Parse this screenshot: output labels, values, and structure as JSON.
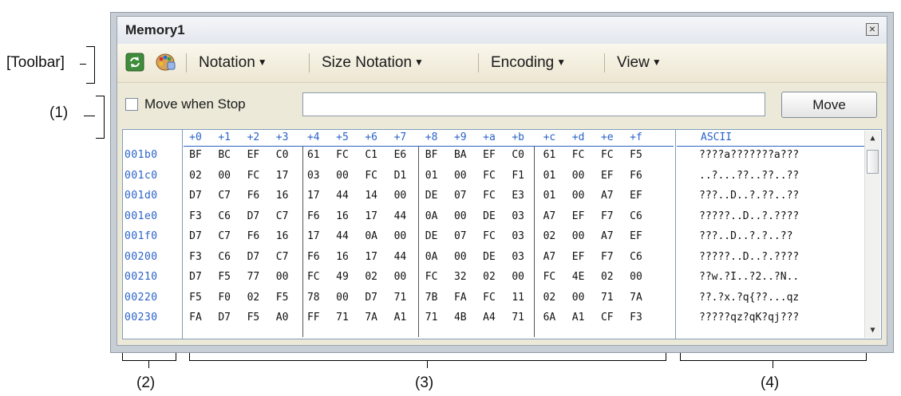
{
  "annotations": {
    "toolbar_label": "[Toolbar]",
    "option_label": "(1)",
    "addr_label": "(2)",
    "data_label": "(3)",
    "ascii_label": "(4)"
  },
  "window": {
    "title": "Memory1",
    "close_icon": "close-icon"
  },
  "toolbar": {
    "refresh_icon": "refresh-icon",
    "palette_icon": "palette-icon",
    "menus": [
      {
        "label": "Notation"
      },
      {
        "label": "Size Notation"
      },
      {
        "label": "Encoding"
      },
      {
        "label": "View"
      }
    ]
  },
  "options": {
    "checkbox_label": "Move when Stop",
    "checked": false,
    "address_value": "",
    "move_button": "Move"
  },
  "grid": {
    "header_offsets": [
      "+0",
      "+1",
      "+2",
      "+3",
      "+4",
      "+5",
      "+6",
      "+7",
      "+8",
      "+9",
      "+a",
      "+b",
      "+c",
      "+d",
      "+e",
      "+f"
    ],
    "ascii_header": "ASCII",
    "rows": [
      {
        "addr": "001b0",
        "bytes": [
          "BF",
          "BC",
          "EF",
          "C0",
          "61",
          "FC",
          "C1",
          "E6",
          "BF",
          "BA",
          "EF",
          "C0",
          "61",
          "FC",
          "FC",
          "F5"
        ],
        "ascii": "????a???????a???"
      },
      {
        "addr": "001c0",
        "bytes": [
          "02",
          "00",
          "FC",
          "17",
          "03",
          "00",
          "FC",
          "D1",
          "01",
          "00",
          "FC",
          "F1",
          "01",
          "00",
          "EF",
          "F6"
        ],
        "ascii": "..?...??..??..??"
      },
      {
        "addr": "001d0",
        "bytes": [
          "D7",
          "C7",
          "F6",
          "16",
          "17",
          "44",
          "14",
          "00",
          "DE",
          "07",
          "FC",
          "E3",
          "01",
          "00",
          "A7",
          "EF"
        ],
        "ascii": "???..D..?.??..??"
      },
      {
        "addr": "001e0",
        "bytes": [
          "F3",
          "C6",
          "D7",
          "C7",
          "F6",
          "16",
          "17",
          "44",
          "0A",
          "00",
          "DE",
          "03",
          "A7",
          "EF",
          "F7",
          "C6"
        ],
        "ascii": "?????..D..?.????"
      },
      {
        "addr": "001f0",
        "bytes": [
          "D7",
          "C7",
          "F6",
          "16",
          "17",
          "44",
          "0A",
          "00",
          "DE",
          "07",
          "FC",
          "03",
          "02",
          "00",
          "A7",
          "EF"
        ],
        "ascii": "???..D..?.?..??"
      },
      {
        "addr": "00200",
        "bytes": [
          "F3",
          "C6",
          "D7",
          "C7",
          "F6",
          "16",
          "17",
          "44",
          "0A",
          "00",
          "DE",
          "03",
          "A7",
          "EF",
          "F7",
          "C6"
        ],
        "ascii": "?????..D..?.????"
      },
      {
        "addr": "00210",
        "bytes": [
          "D7",
          "F5",
          "77",
          "00",
          "FC",
          "49",
          "02",
          "00",
          "FC",
          "32",
          "02",
          "00",
          "FC",
          "4E",
          "02",
          "00"
        ],
        "ascii": "??w.?I..?2..?N.."
      },
      {
        "addr": "00220",
        "bytes": [
          "F5",
          "F0",
          "02",
          "F5",
          "78",
          "00",
          "D7",
          "71",
          "7B",
          "FA",
          "FC",
          "11",
          "02",
          "00",
          "71",
          "7A"
        ],
        "ascii": "??.?x.?q{??...qz"
      },
      {
        "addr": "00230",
        "bytes": [
          "FA",
          "D7",
          "F5",
          "A0",
          "FF",
          "71",
          "7A",
          "A1",
          "71",
          "4B",
          "A4",
          "71",
          "6A",
          "A1",
          "CF",
          "F3"
        ],
        "ascii": "?????qz?qK?qj???"
      }
    ]
  },
  "scrollbar": {
    "up_icon": "scroll-up-icon",
    "down_icon": "scroll-down-icon"
  }
}
